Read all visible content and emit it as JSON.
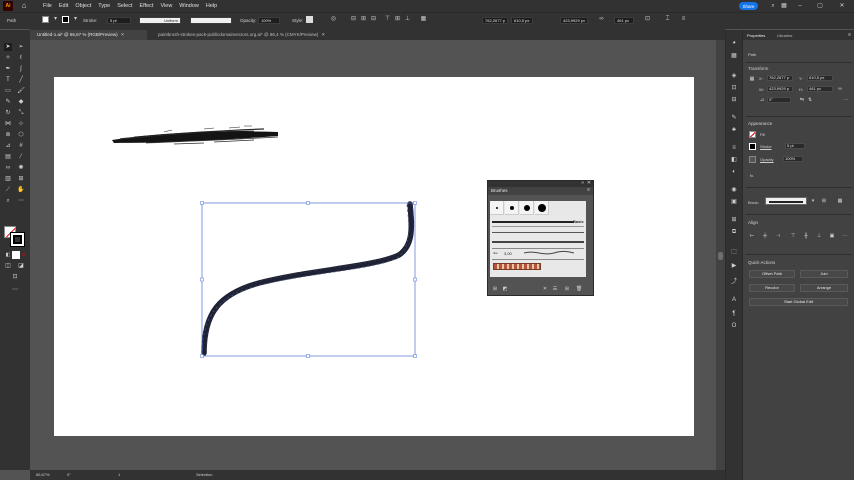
{
  "app": {
    "logo": "Ai",
    "home_icon": "home-icon"
  },
  "menu": [
    "File",
    "Edit",
    "Object",
    "Type",
    "Select",
    "Effect",
    "View",
    "Window",
    "Help"
  ],
  "share_label": "Share",
  "control_bar": {
    "selection_label": "Path",
    "stroke_label": "Stroke:",
    "stroke_value": "5 pt",
    "profile_label": "Uniform",
    "opacity_label": "Opacity:",
    "opacity_value": "100%",
    "style_label": "Style:",
    "x_value": "762,2677 p",
    "y_value": "610,5 px",
    "w_value": "423,9929 px",
    "h_value": "461 px"
  },
  "tabs": [
    {
      "label": "Untitled-1.ai* @ 66,67 % (RGB/Preview)",
      "active": true
    },
    {
      "label": "paintbrush-strokes-pack-publicdomainvectors.org.ai* @ 86,4 % (CMYK/Preview)",
      "active": false
    }
  ],
  "brushes_panel": {
    "title": "Brushes",
    "basic_label": "Basic",
    "size_label": "3,00"
  },
  "status": {
    "zoom": "66,67%",
    "rotation": "0°",
    "artboard": "1",
    "tool": "Selection"
  },
  "properties": {
    "tab_properties": "Properties",
    "tab_libraries": "Libraries",
    "path_label": "Path",
    "transform_title": "Transform",
    "x_label": "X:",
    "x_value": "762,2677 p",
    "y_label": "Y:",
    "y_value": "610,5 px",
    "w_label": "W:",
    "w_value": "423,9929 p",
    "h_label": "H:",
    "h_value": "461 px",
    "rotate_value": "0°",
    "appearance_title": "Appearance",
    "fill_label": "Fill",
    "stroke_label": "Stroke",
    "stroke_value": "5 pt",
    "opacity_label": "Opacity",
    "opacity_value": "100%",
    "fx_label": "fx.",
    "brush_label": "Brush",
    "align_title": "Align",
    "quick_actions_title": "Quick Actions",
    "offset_path": "Offset Path",
    "join": "Join",
    "recolor": "Recolor",
    "arrange": "Arrange",
    "start_global_edit": "Start Global Edit"
  },
  "colors": {
    "ui_dark": "#323232",
    "ui_mid": "#424242",
    "canvas_bg": "#535353",
    "artboard": "#ffffff",
    "share_blue": "#1473e6",
    "selection_blue": "#4a6fd6",
    "stroke_ink": "#1f2233"
  }
}
